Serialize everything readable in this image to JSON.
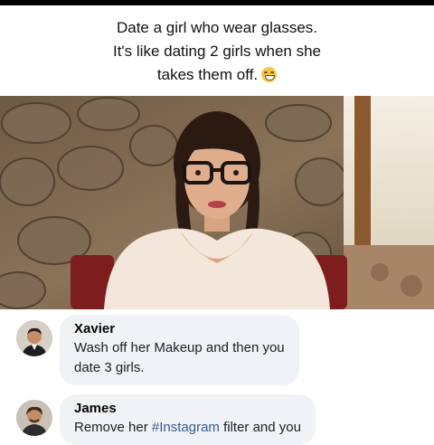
{
  "post": {
    "caption_line1": "Date a girl who wear glasses.",
    "caption_line2": "It's like dating 2 girls when she",
    "caption_line3": "takes them off.",
    "emoji": "grinning-face-emoji"
  },
  "comments": [
    {
      "author": "Xavier",
      "text_line1": "Wash off her Makeup and then you",
      "text_line2": "date 3 girls."
    },
    {
      "author": "James",
      "text_before": "Remove her ",
      "hashtag": "#Instagram",
      "text_after": " filter and you"
    }
  ],
  "colors": {
    "hashtag": "#385898",
    "comment_bubble": "#f0f2f5",
    "background": "#ffffff"
  }
}
